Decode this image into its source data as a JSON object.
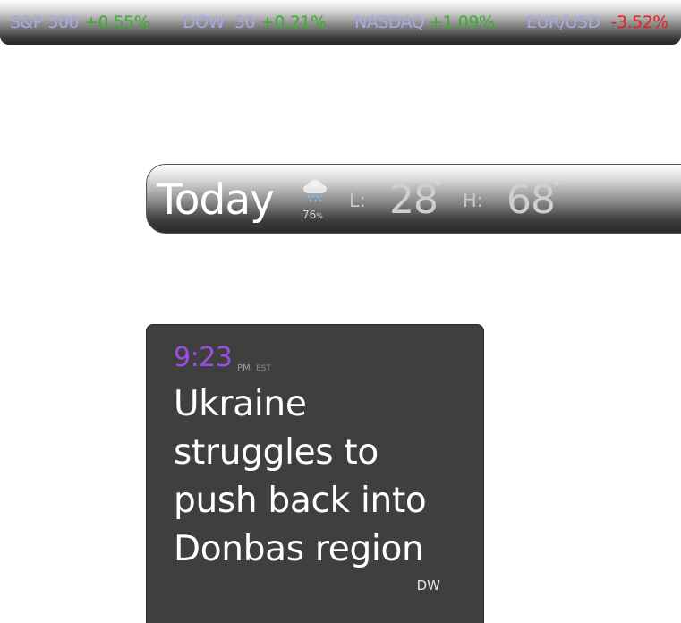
{
  "ticker": {
    "items": [
      {
        "name": "S&P 500",
        "change": "+0.55%",
        "direction": "up"
      },
      {
        "name": "DOW  30",
        "change": "+0.21%",
        "direction": "up"
      },
      {
        "name": "NASDAQ",
        "change": "+1.09%",
        "direction": "up"
      },
      {
        "name": "EUR/USD",
        "change": "-3.52%",
        "direction": "down"
      }
    ],
    "colors": {
      "up": "#3ab02a",
      "down": "#e6201c",
      "name": "#a8a8e6"
    }
  },
  "weather": {
    "day": "Today",
    "icon": "rain-cloud-icon",
    "precip_value": "76",
    "precip_unit": "%",
    "low_label": "L:",
    "low_temp": "28",
    "high_label": "H:",
    "high_temp": "68",
    "degree_symbol": "°"
  },
  "news": {
    "time": "9:23",
    "ampm": "PM",
    "timezone": "EST",
    "headline": "Ukraine struggles to push back into Donbas region",
    "source": "DW",
    "time_color": "#9b4ee4"
  }
}
